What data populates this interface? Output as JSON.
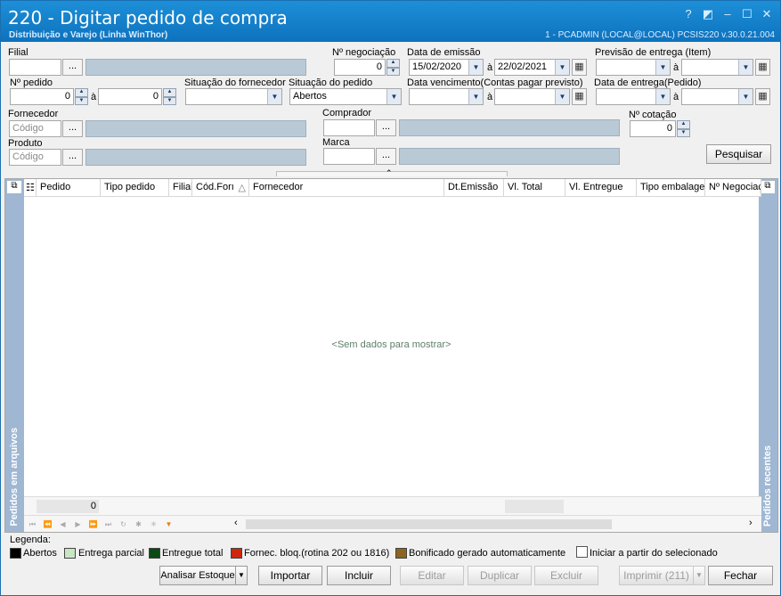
{
  "window": {
    "title": "220 - Digitar pedido de compra",
    "subtitle": "Distribuição e Varejo (Linha WinThor)",
    "status": "1 - PCADMIN (LOCAL@LOCAL)   PCSIS220  v.30.0.21.004"
  },
  "filters": {
    "filial_label": "Filial",
    "negociacao_label": "Nº negociação",
    "negociacao_value": "0",
    "emissao_label": "Data de emissão",
    "emissao_from": "15/02/2020",
    "emissao_to": "22/02/2021",
    "a_label": "à",
    "previsao_label": "Previsão  de entrega (Item)",
    "pedido_label": "Nº pedido",
    "pedido_from": "0",
    "pedido_to": "0",
    "sit_fornecedor_label": "Situação do fornecedor",
    "sit_pedido_label": "Situação do pedido",
    "sit_pedido_value": "Abertos",
    "vencimento_label": "Data vencimento(Contas pagar previsto)",
    "entrega_pedido_label": "Data de entrega(Pedido)",
    "fornecedor_label": "Fornecedor",
    "fornecedor_placeholder": "Código",
    "comprador_label": "Comprador",
    "cotacao_label": "Nº cotação",
    "cotacao_value": "0",
    "produto_label": "Produto",
    "produto_placeholder": "Código",
    "marca_label": "Marca",
    "dots": "...",
    "pesquisar_label": "Pesquisar"
  },
  "grid": {
    "columns": [
      "Pedido",
      "Tipo pedido",
      "Filial",
      "Cód.Forı",
      "Fornecedor",
      "Dt.Emissão",
      "Vl. Total",
      "Vl. Entregue",
      "Tipo embalager",
      "Nº Negociaç"
    ],
    "empty_text": "<Sem dados para mostrar>",
    "left_panel": "Pedidos em arquivos",
    "right_panel": "Pedidos recentes",
    "footer_count": "0"
  },
  "legend": {
    "title": "Legenda:",
    "items": [
      {
        "label": "Abertos",
        "color": "#000000"
      },
      {
        "label": "Entrega parcial",
        "color": "#c8e6c4"
      },
      {
        "label": "Entregue total",
        "color": "#0b4a12"
      },
      {
        "label": "Fornec. bloq.(rotina 202 ou 1816)",
        "color": "#d0260e"
      },
      {
        "label": "Bonificado gerado automaticamente",
        "color": "#8a6420"
      }
    ],
    "iniciar_label": "Iniciar a partir do selecionado"
  },
  "actions": {
    "analisar": "Analisar Estoque",
    "importar": "Importar",
    "incluir": "Incluir",
    "editar": "Editar",
    "duplicar": "Duplicar",
    "excluir": "Excluir",
    "imprimir": "Imprimir (211)",
    "fechar": "Fechar"
  }
}
